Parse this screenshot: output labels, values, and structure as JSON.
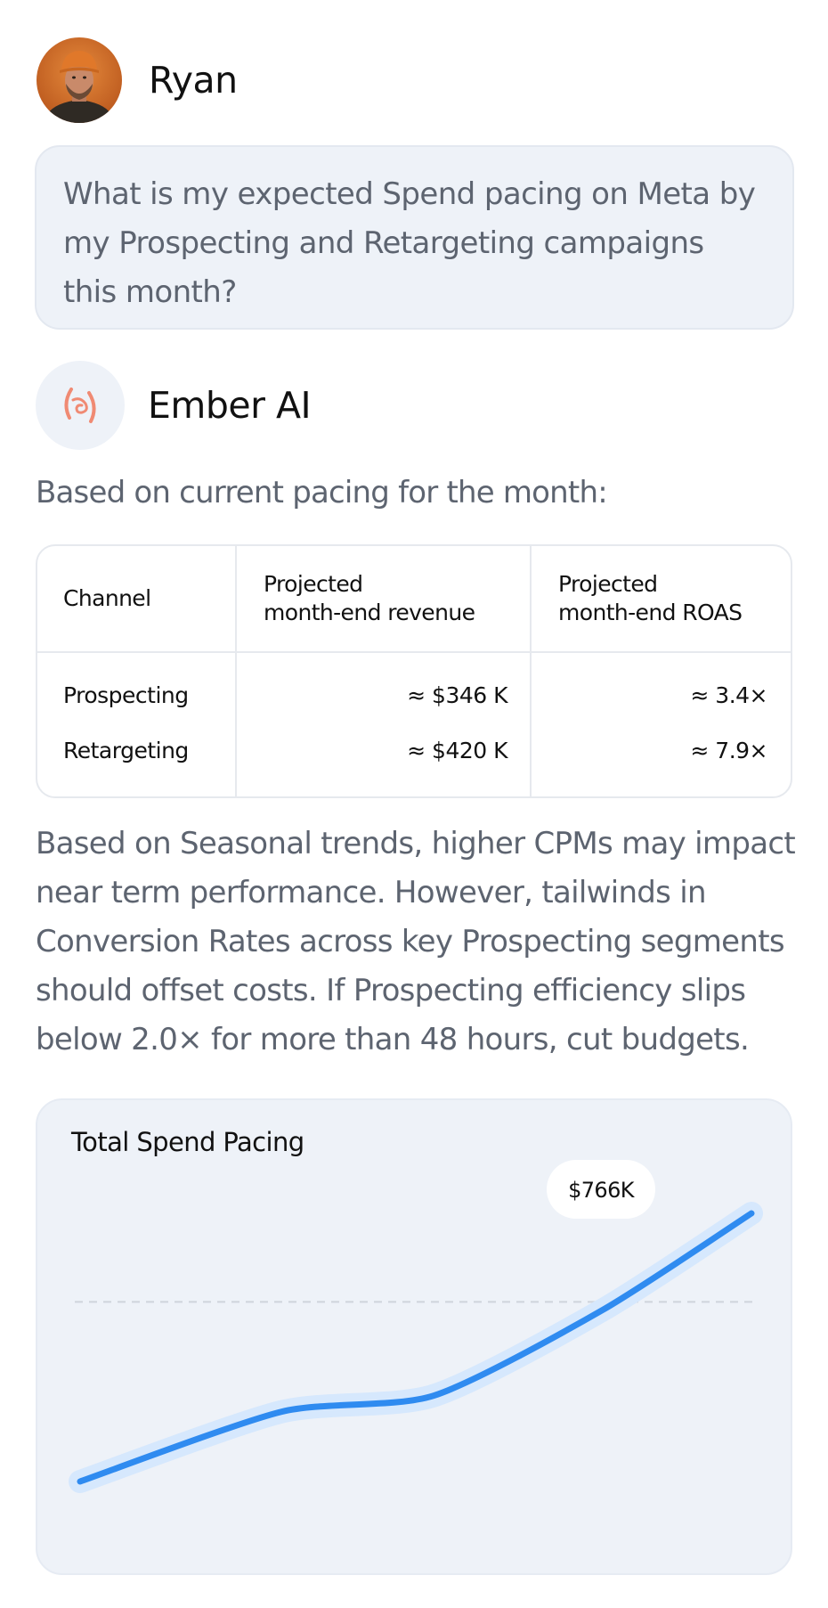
{
  "user": {
    "name": "Ryan",
    "question": "What is my expected Spend pacing on Meta by my Prospecting and Retargeting campaigns this month?"
  },
  "assistant": {
    "name": "Ember AI",
    "intro": "Based on current pacing for the month:",
    "table": {
      "headers": [
        "Channel",
        "Projected\nmonth-end revenue",
        "Projected\nmonth-end ROAS"
      ],
      "rows": [
        [
          "Prospecting",
          "≈ $346 K",
          "≈ 3.4×"
        ],
        [
          "Retargeting",
          "≈ $420 K",
          "≈ 7.9×"
        ]
      ]
    },
    "paragraph": "Based on Seasonal trends, higher CPMs may impact near term performance. However, tailwinds in Conversion Rates across key Prospecting segments should offset costs. If Prospecting efficiency slips below 2.0× for more than 48 hours, cut budgets."
  },
  "chart": {
    "title": "Total Spend Pacing",
    "callout": "$766K"
  },
  "chart_data": {
    "type": "line",
    "title": "Total Spend Pacing",
    "xlabel": "",
    "ylabel": "",
    "grid": false,
    "series": [
      {
        "values": [
          0,
          0.26,
          0.32,
          0.64,
          1.0
        ]
      }
    ],
    "reference_line": 0.67,
    "end_label": "$766K",
    "colors": {
      "line": "#2f8bf0",
      "halo": "#d6e8fd",
      "reference": "#cfd4dc"
    }
  },
  "colors": {
    "bubble_bg": "#eef2f8",
    "muted_text": "#5d6470",
    "accent_logo": "#f08a73"
  }
}
